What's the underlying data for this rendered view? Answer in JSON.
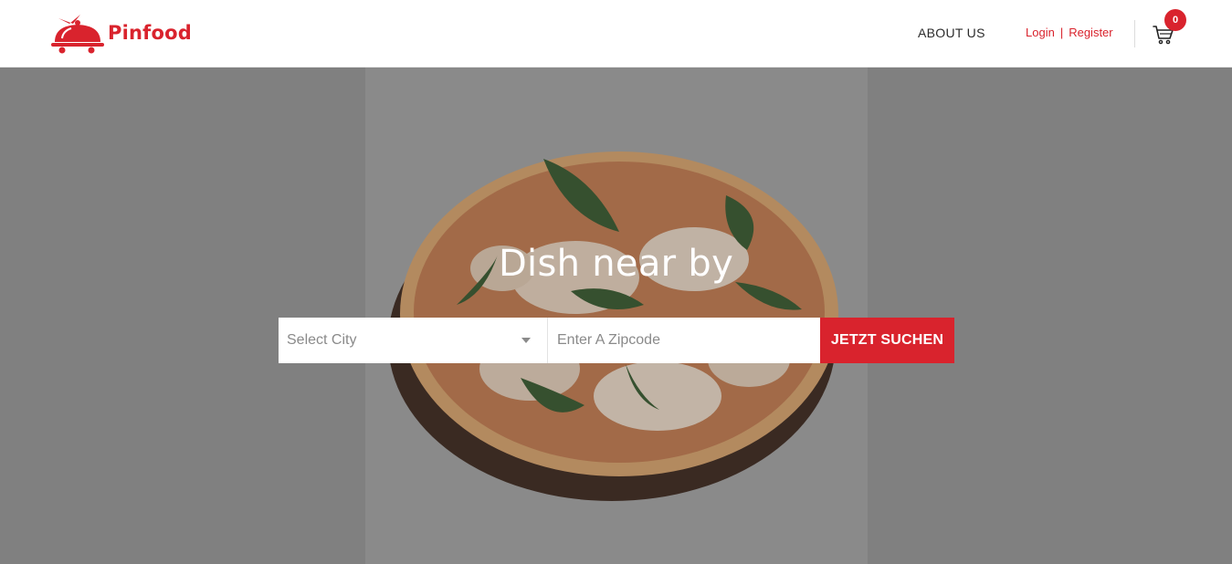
{
  "brand": {
    "name": "Pinfood",
    "accent_color": "#d9232d",
    "logo_icon": "food-cloche-icon"
  },
  "nav": {
    "about": "ABOUT US",
    "login": "Login",
    "separator": "|",
    "register": "Register",
    "cart_icon": "cart-icon",
    "cart_count": "0"
  },
  "hero": {
    "title": "Dish near by",
    "background_image": "pizza-photo",
    "search": {
      "city_value": "Select City",
      "zip_placeholder": "Enter A Zipcode",
      "button_label": "JETZT SUCHEN"
    }
  }
}
